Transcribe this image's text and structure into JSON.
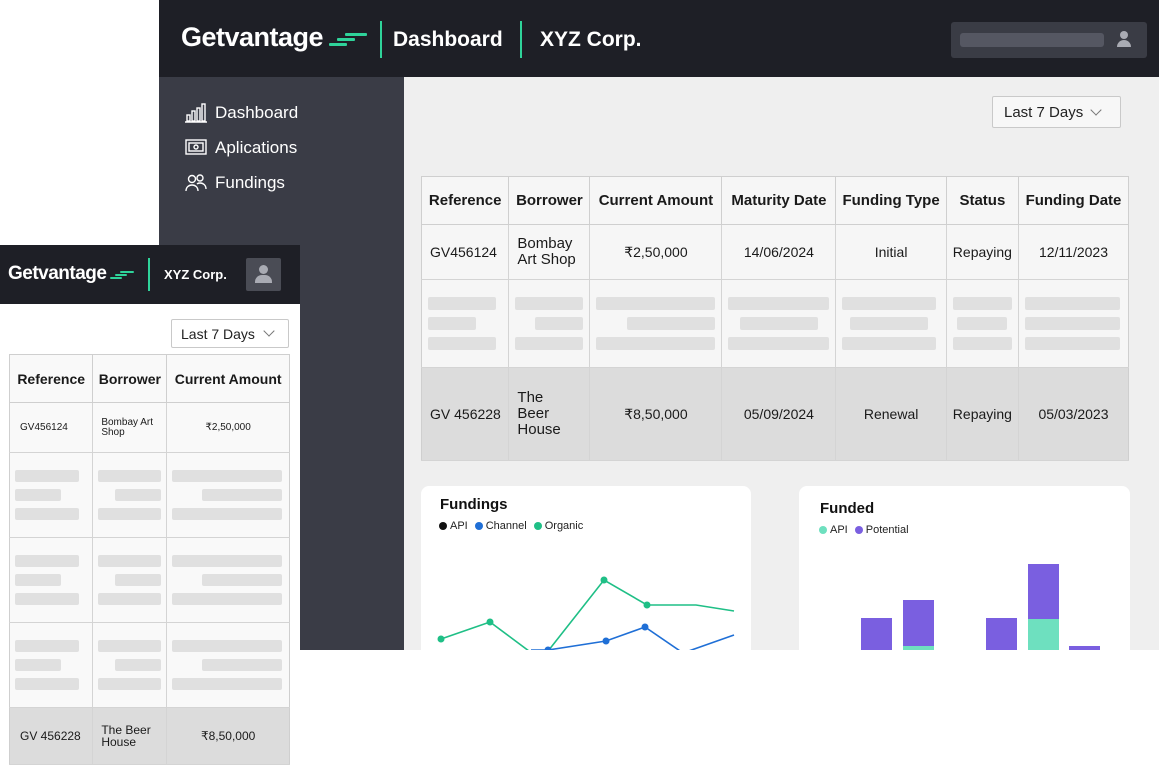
{
  "brand": {
    "name": "Getvantage",
    "accent": "#2fd39a"
  },
  "desktop": {
    "header": {
      "page_title": "Dashboard",
      "company": "XYZ Corp."
    },
    "sidebar": {
      "items": [
        {
          "label": "Dashboard",
          "icon": "bar-chart-icon"
        },
        {
          "label": "Aplications",
          "icon": "document-icon"
        },
        {
          "label": "Fundings",
          "icon": "users-icon"
        }
      ]
    },
    "date_range": "Last 7 Days",
    "table": {
      "columns": [
        "Reference",
        "Borrower",
        "Current Amount",
        "Maturity Date",
        "Funding Type",
        "Status",
        "Funding Date"
      ],
      "rows": [
        {
          "reference": "GV456124",
          "borrower": "Bombay Art Shop",
          "current_amount": "₹2,50,000",
          "maturity_date": "14/06/2024",
          "funding_type": "Initial",
          "status": "Repaying",
          "funding_date": "12/11/2023"
        },
        {
          "reference": "GV 456228",
          "borrower": "The Beer House",
          "current_amount": "₹8,50,000",
          "maturity_date": "05/09/2024",
          "funding_type": "Renewal",
          "status": "Repaying",
          "funding_date": "05/03/2023"
        }
      ]
    },
    "fundings_chart": {
      "title": "Fundings",
      "legend": [
        {
          "name": "API",
          "color": "#111111"
        },
        {
          "name": "Channel",
          "color": "#1f6fd6"
        },
        {
          "name": "Organic",
          "color": "#1fbf86"
        }
      ]
    },
    "funded_chart": {
      "title": "Funded",
      "legend": [
        {
          "name": "API",
          "color": "#6ee0bf"
        },
        {
          "name": "Potential",
          "color": "#7a5fe0"
        }
      ]
    }
  },
  "mobile": {
    "header": {
      "company": "XYZ Corp."
    },
    "date_range": "Last 7 Days",
    "table": {
      "columns": [
        "Reference",
        "Borrower",
        "Current Amount"
      ],
      "rows": [
        {
          "reference": "GV456124",
          "borrower": "Bombay Art Shop",
          "current_amount": "₹2,50,000"
        },
        {
          "reference": "GV 456228",
          "borrower": "The Beer House",
          "current_amount": "₹8,50,000"
        }
      ]
    }
  }
}
